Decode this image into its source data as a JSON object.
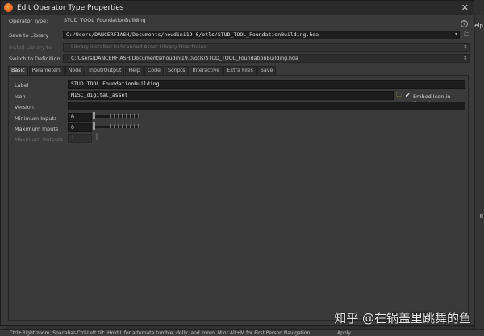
{
  "window": {
    "title": "Edit Operator Type Properties",
    "close_icon": "close-icon"
  },
  "header": {
    "operator_type_label": "Operator Type:",
    "operator_type_value": "STUD_TOOL_FoundationBuilding",
    "help_icon": "?"
  },
  "save_to_library": {
    "label": "Save to Library",
    "value": "C:/Users/DANCERFIASH/Documents/houdini19.0/otls/STUD_TOOL_FoundationBuilding.hda"
  },
  "install_library": {
    "label": "Install Library to",
    "value": "Library installed to Scanned Asset Library Directories"
  },
  "switch_to_definition": {
    "label": "Switch to Definition",
    "value": "C:/Users/DANCERFIASH/Documents/houdini19.0/otls/STUD_TOOL_FoundationBuilding.hda"
  },
  "tabs": [
    "Basic",
    "Parameters",
    "Node",
    "Input/Output",
    "Help",
    "Code",
    "Scripts",
    "Interactive",
    "Extra Files",
    "Save"
  ],
  "basic": {
    "label_label": "Label",
    "label_value": "STUD TOOL FoundationBuilding",
    "icon_label": "Icon",
    "icon_value": "MISC_digital_asset",
    "embed_icon_label": "Embed Icon in Operator",
    "embed_icon_checked": true,
    "version_label": "Version",
    "version_value": "",
    "min_inputs_label": "Minimum Inputs",
    "min_inputs_value": "0",
    "max_inputs_label": "Maximum Inputs",
    "max_inputs_value": "0",
    "max_outputs_label": "Maximum Outputs",
    "max_outputs_value": "1"
  },
  "background": {
    "hint": "... Ctrl+Right zoom, Spacebar-Ctrl-Left tilt. Hold L for alternate tumble, dolly, and zoom.     M or Alt+M for First Person Navigation.",
    "apply": "Apply",
    "right_label_1": "elp",
    "right_label_2": "o"
  },
  "watermark": "知乎 @在锅盖里跳舞的鱼"
}
